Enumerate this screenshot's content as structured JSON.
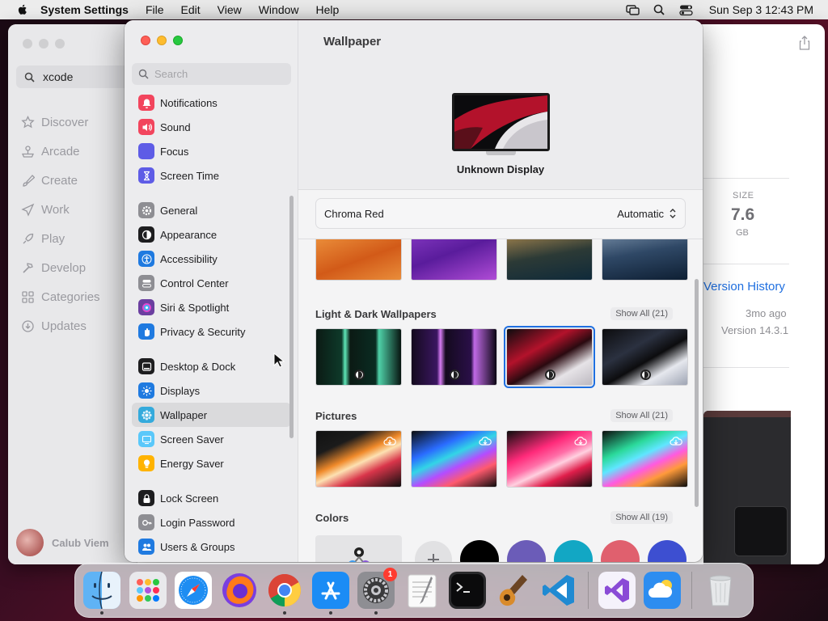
{
  "menubar": {
    "app_name": "System Settings",
    "menus": [
      "File",
      "Edit",
      "View",
      "Window",
      "Help"
    ],
    "clock": "Sun Sep 3  12:43 PM"
  },
  "store": {
    "search_value": "xcode",
    "nav": [
      "Discover",
      "Arcade",
      "Create",
      "Work",
      "Play",
      "Develop",
      "Categories",
      "Updates"
    ],
    "user_name": "Calub Viem",
    "size_label": "SIZE",
    "size_value": "7.6",
    "size_unit": "GB",
    "version_history": "Version History",
    "updated_ago": "3mo ago",
    "version": "Version 14.3.1"
  },
  "settings": {
    "search_placeholder": "Search",
    "sidebar_groups": [
      [
        {
          "label": "Notifications",
          "icon": "bell-icon",
          "color": "#f2455d"
        },
        {
          "label": "Sound",
          "icon": "speaker-icon",
          "color": "#f2455d"
        },
        {
          "label": "Focus",
          "icon": "moon-icon",
          "color": "#5e5ce6"
        },
        {
          "label": "Screen Time",
          "icon": "hourglass-icon",
          "color": "#5e5ce6"
        }
      ],
      [
        {
          "label": "General",
          "icon": "gear-icon",
          "color": "#8e8e93"
        },
        {
          "label": "Appearance",
          "icon": "appearance-icon",
          "color": "#1d1d1f"
        },
        {
          "label": "Accessibility",
          "icon": "accessibility-icon",
          "color": "#1f7ae0"
        },
        {
          "label": "Control Center",
          "icon": "control-center-icon",
          "color": "#8e8e93"
        },
        {
          "label": "Siri & Spotlight",
          "icon": "siri-icon",
          "color": "#6b3fa0"
        },
        {
          "label": "Privacy & Security",
          "icon": "hand-icon",
          "color": "#1f7ae0"
        }
      ],
      [
        {
          "label": "Desktop & Dock",
          "icon": "dock-icon",
          "color": "#1d1d1f"
        },
        {
          "label": "Displays",
          "icon": "sun-icon",
          "color": "#1f7ae0"
        },
        {
          "label": "Wallpaper",
          "icon": "wallpaper-icon",
          "color": "#34aadc"
        },
        {
          "label": "Screen Saver",
          "icon": "screen-saver-icon",
          "color": "#5ac8fa"
        },
        {
          "label": "Energy Saver",
          "icon": "bulb-icon",
          "color": "#ffb300"
        }
      ],
      [
        {
          "label": "Lock Screen",
          "icon": "lock-icon",
          "color": "#1d1d1f"
        },
        {
          "label": "Login Password",
          "icon": "key-icon",
          "color": "#8e8e93"
        },
        {
          "label": "Users & Groups",
          "icon": "users-icon",
          "color": "#1f7ae0"
        }
      ]
    ],
    "selected_item": "Wallpaper",
    "content_title": "Wallpaper",
    "display_name": "Unknown Display",
    "current_wallpaper": "Chroma Red",
    "appearance_mode": "Automatic",
    "sections": {
      "light_dark": {
        "title": "Light & Dark Wallpapers",
        "show_all": "Show All (21)"
      },
      "pictures": {
        "title": "Pictures",
        "show_all": "Show All (21)"
      },
      "colors": {
        "title": "Colors",
        "show_all": "Show All (19)"
      }
    },
    "color_swatches": [
      "#000000",
      "#6b5cb8",
      "#12a7c4",
      "#e0606e",
      "#3d4fd1"
    ]
  },
  "dock": {
    "apps": [
      "finder-icon",
      "launchpad-icon",
      "safari-icon",
      "firefox-icon",
      "chrome-icon",
      "app-store-icon",
      "system-settings-icon",
      "textedit-icon",
      "terminal-icon",
      "instruments-icon",
      "vscode-icon",
      "visual-studio-icon",
      "weather-icon",
      "trash-icon"
    ],
    "settings_badge": "1"
  }
}
